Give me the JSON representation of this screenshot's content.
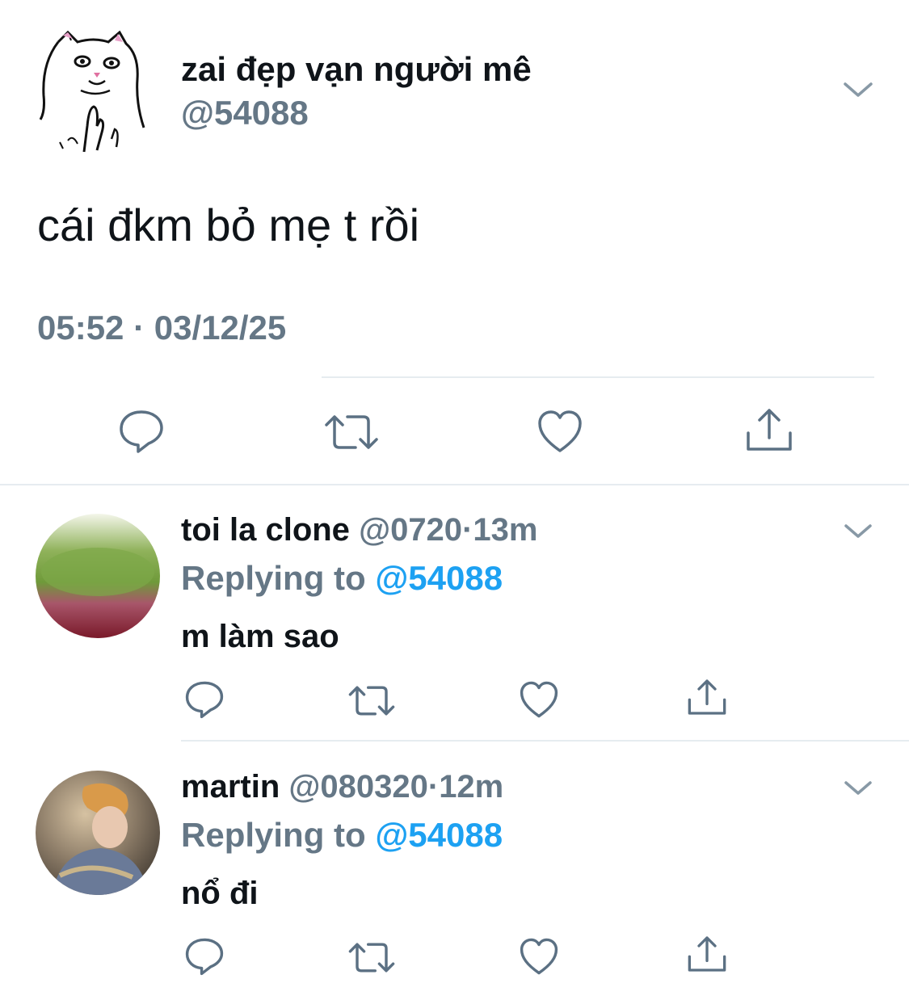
{
  "main_tweet": {
    "display_name": "zai đẹp vạn người mê",
    "handle": "@54088",
    "text": "cái đkm bỏ mẹ t rồi",
    "timestamp": "05:52 · 03/12/25",
    "avatar": "cat-middle-finger-sketch"
  },
  "actions": {
    "reply_icon": "reply-bubble-icon",
    "retweet_icon": "retweet-icon",
    "like_icon": "heart-icon",
    "share_icon": "share-icon"
  },
  "replies": [
    {
      "display_name": "toi la clone",
      "handle": "@0720",
      "separator": "·",
      "time_ago": "13m",
      "replying_prefix": "Replying to ",
      "replying_to": "@54088",
      "text": "m làm sao",
      "avatar": "blurred-green-avatar"
    },
    {
      "display_name": "martin",
      "handle": "@080320",
      "separator": "·",
      "time_ago": "12m",
      "replying_prefix": "Replying to ",
      "replying_to": "@54088",
      "text": "nổ đi",
      "avatar": "person-photo-avatar"
    }
  ],
  "colors": {
    "text_primary": "#0f1419",
    "text_secondary": "#657786",
    "link": "#1da1f2",
    "divider": "#e6ecf0"
  }
}
